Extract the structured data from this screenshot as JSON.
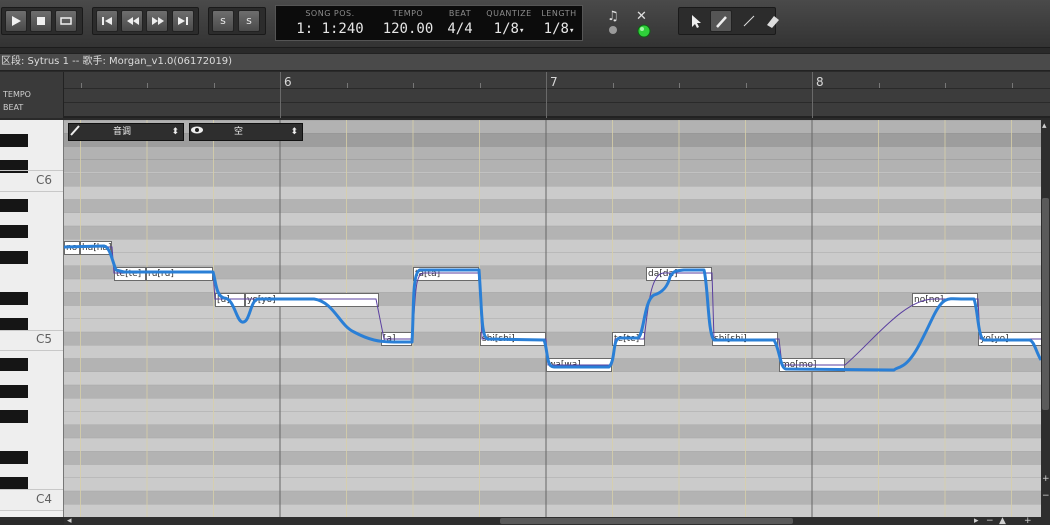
{
  "toolbar": {
    "transport": [
      {
        "name": "play-icon",
        "glyph": "play"
      },
      {
        "name": "stop-icon",
        "glyph": "stop"
      },
      {
        "name": "loop-icon",
        "glyph": "loop"
      }
    ],
    "nav": [
      {
        "name": "skip-start-icon"
      },
      {
        "name": "rewind-icon"
      },
      {
        "name": "fast-forward-icon"
      },
      {
        "name": "skip-end-icon"
      }
    ],
    "snap_buttons": [
      {
        "name": "snap-icon",
        "label": "s"
      },
      {
        "name": "step-icon",
        "label": "s"
      }
    ],
    "lcd": {
      "song_pos_label": "SONG POS.",
      "song_pos": "1: 1:240",
      "tempo_label": "TEMPO",
      "tempo": "120.00",
      "beat_label": "BEAT",
      "beat": "4/4",
      "quantize_label": "QUANTIZE",
      "quantize": "1/8",
      "length_label": "LENGTH",
      "length": "1/8"
    },
    "tools": [
      "select-tool-icon",
      "pencil-tool-icon",
      "line-tool-icon",
      "eraser-tool-icon"
    ]
  },
  "info_bar": {
    "text": "区段: Sytrus 1  --  歌手: Morgan_v1.0(06172019)"
  },
  "left_header": {
    "tempo_label": "TEMPO",
    "beat_label": "BEAT"
  },
  "ruler": {
    "bars": [
      "6",
      "7",
      "8"
    ]
  },
  "piano": {
    "octave_labels": [
      "C6",
      "C5",
      "C4"
    ]
  },
  "param_selectors": {
    "edit_param": "音调",
    "view_param": "空"
  },
  "notes": [
    {
      "label": "no"
    },
    {
      "label": "ha[ha]"
    },
    {
      "label": "te[te]"
    },
    {
      "label": "ru[ru]"
    },
    {
      "label": "[u]"
    },
    {
      "label": "yo[yo]"
    },
    {
      "label": "[a]"
    },
    {
      "label": "ta[ta]"
    },
    {
      "label": "shi[shi]"
    },
    {
      "label": "wa[wa]"
    },
    {
      "label": "te[te]"
    },
    {
      "label": "da[da]"
    },
    {
      "label": "shi[shi]"
    },
    {
      "label": "mo[mo]"
    },
    {
      "label": "no[no]"
    },
    {
      "label": "yo[yo]"
    }
  ],
  "colors": {
    "pitch_curve": "#2a7fd6",
    "note_base_line": "#5a3fa0",
    "note_fill": "#ffffff",
    "led_green": "#2fd03a"
  }
}
